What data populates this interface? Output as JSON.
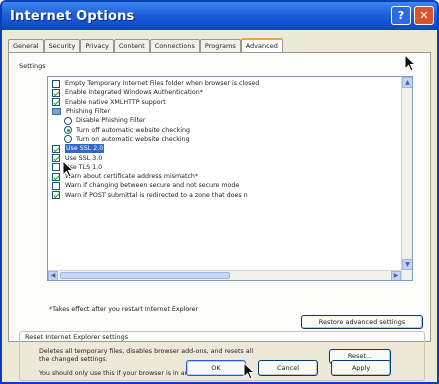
{
  "window": {
    "title": "Internet Options",
    "help_glyph": "?",
    "close_glyph": "✕"
  },
  "tabs": [
    {
      "label": "General"
    },
    {
      "label": "Security"
    },
    {
      "label": "Privacy"
    },
    {
      "label": "Content"
    },
    {
      "label": "Connections"
    },
    {
      "label": "Programs"
    },
    {
      "label": "Advanced",
      "active": true
    }
  ],
  "settings": {
    "group_label": "Settings",
    "items": [
      {
        "label": "Empty Temporary Internet Files folder when browser is closed",
        "checked": false,
        "kind": "checkbox"
      },
      {
        "label": "Enable Integrated Windows Authentication*",
        "checked": true,
        "kind": "checkbox"
      },
      {
        "label": "Enable native XMLHTTP support",
        "checked": true,
        "kind": "checkbox"
      },
      {
        "label": "Phishing Filter",
        "checked": null,
        "kind": "folder"
      },
      {
        "label": "Disable Phishing Filter",
        "checked": false,
        "kind": "radio"
      },
      {
        "label": "Turn off automatic website checking",
        "checked": true,
        "kind": "radio"
      },
      {
        "label": "Turn on automatic website checking",
        "checked": false,
        "kind": "radio"
      },
      {
        "label": "Use SSL 2.0",
        "checked": true,
        "kind": "checkbox",
        "selected": true
      },
      {
        "label": "Use SSL 3.0",
        "checked": true,
        "kind": "checkbox"
      },
      {
        "label": "Use TLS 1.0",
        "checked": false,
        "kind": "checkbox"
      },
      {
        "label": "Warn about certificate address mismatch*",
        "checked": true,
        "kind": "checkbox"
      },
      {
        "label": "Warn if changing between secure and not secure mode",
        "checked": false,
        "kind": "checkbox"
      },
      {
        "label": "Warn if POST submittal is redirected to a zone that does n",
        "checked": true,
        "kind": "checkbox"
      }
    ],
    "note": "*Takes effect after you restart Internet Explorer",
    "restore_button": "Restore advanced settings"
  },
  "reset": {
    "group_label": "Reset Internet Explorer settings",
    "description": "Deletes all temporary files, disables browser add-ons, and resets all the changed settings.",
    "warning": "You should only use this if your browser is in an unusable state.",
    "button": "Reset..."
  },
  "footer": {
    "ok": "OK",
    "cancel": "Cancel",
    "apply": "Apply"
  },
  "colors": {
    "titlebar": "#1e5fd8",
    "selection": "#316ac5",
    "active_tab_accent": "#f3a33a"
  }
}
